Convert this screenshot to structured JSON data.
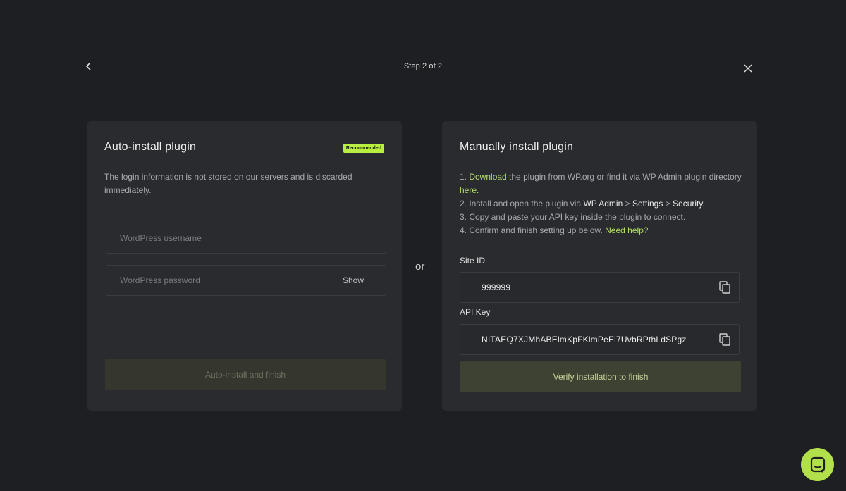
{
  "header": {
    "step": "Step 2 of 2"
  },
  "auto": {
    "title": "Auto-install plugin",
    "badge": "Recommended",
    "description": "The login information is not stored on our servers and is discarded immediately.",
    "username_placeholder": "WordPress username",
    "password_placeholder": "WordPress password",
    "show_label": "Show",
    "button_label": "Auto-install and finish"
  },
  "or_label": "or",
  "manual": {
    "title": "Manually install plugin",
    "steps": {
      "s1_prefix": "1. ",
      "s1_link": "Download",
      "s1_mid": " the plugin from WP.org or find it via WP Admin plugin directory ",
      "s1_link2": "here.",
      "s2_prefix": "2. Install and open the plugin via ",
      "s2_a": "WP Admin",
      "s2_sep1": " > ",
      "s2_b": "Settings",
      "s2_sep2": " > ",
      "s2_c": "Security.",
      "s3": "3. Copy and paste your API key inside the plugin to connect.",
      "s4_prefix": "4. Confirm and finish setting up below. ",
      "s4_link": "Need help?"
    },
    "site_id_label": "Site ID",
    "site_id_value": "999999",
    "api_key_label": "API Key",
    "api_key_value": "NITAEQ7XJMhABElmKpFKlmPeEl7UvbRPthLdSPgz",
    "verify_label": "Verify installation to finish"
  },
  "colors": {
    "accent": "#b9ef3f",
    "link": "#b0dd67",
    "background": "#1e1f22",
    "card": "#2a2b2f"
  },
  "icons": {
    "back": "chevron-left-icon",
    "close": "close-icon",
    "copy": "copy-icon",
    "chat": "chat-icon"
  }
}
